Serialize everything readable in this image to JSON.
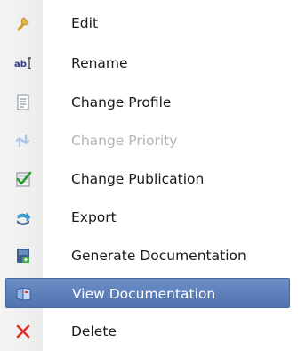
{
  "menu": {
    "items": [
      {
        "label": "Edit",
        "icon": "wrench-icon",
        "state": "enabled"
      },
      {
        "label": "Rename",
        "icon": "rename-icon",
        "state": "enabled"
      },
      {
        "label": "Change Profile",
        "icon": "profile-list-icon",
        "state": "enabled"
      },
      {
        "label": "Change Priority",
        "icon": "priority-arrows-icon",
        "state": "disabled"
      },
      {
        "label": "Change Publication",
        "icon": "publication-check-icon",
        "state": "enabled"
      },
      {
        "label": "Export",
        "icon": "export-arrow-icon",
        "state": "enabled"
      },
      {
        "label": "Generate Documentation",
        "icon": "generate-document-icon",
        "state": "enabled"
      },
      {
        "label": "View Documentation",
        "icon": "view-book-icon",
        "state": "selected"
      },
      {
        "label": "Delete",
        "icon": "delete-x-icon",
        "state": "enabled"
      }
    ],
    "colors": {
      "selected_background": "#5a7cb9",
      "disabled_text": "#b4b4b4",
      "delete_icon": "#e0302a"
    }
  }
}
